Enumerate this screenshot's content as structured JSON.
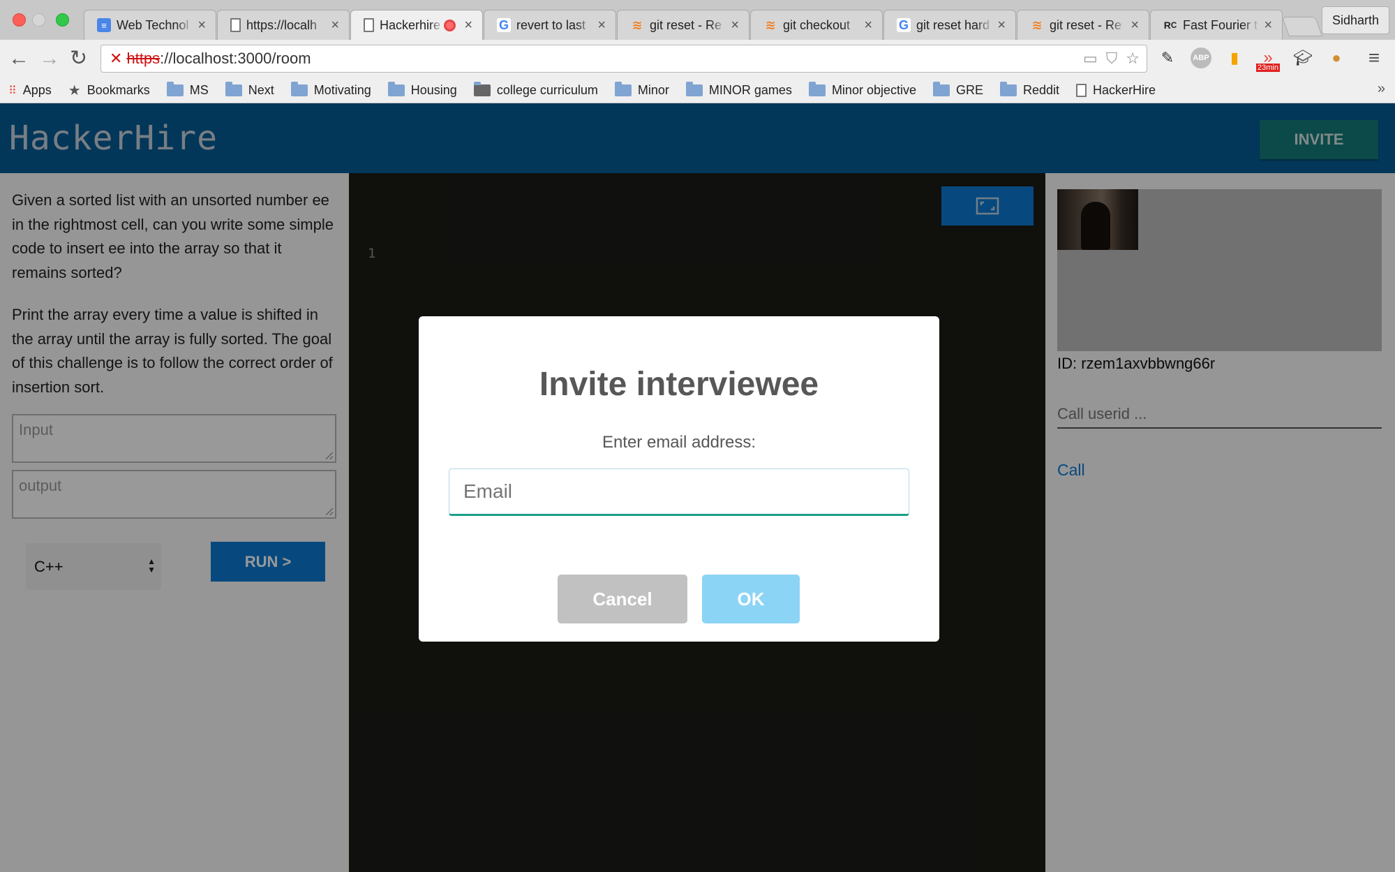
{
  "browser": {
    "tabs": [
      {
        "title": "Web Technol",
        "icon": "docs-icon"
      },
      {
        "title": "https://localh",
        "icon": "page-icon"
      },
      {
        "title": "Hackerhire",
        "icon": "page-icon",
        "active": true,
        "recording": true
      },
      {
        "title": "revert to last",
        "icon": "google-icon"
      },
      {
        "title": "git reset - Re",
        "icon": "stackoverflow-icon"
      },
      {
        "title": "git checkout",
        "icon": "stackoverflow-icon"
      },
      {
        "title": "git reset hard",
        "icon": "google-icon"
      },
      {
        "title": "git reset - Re",
        "icon": "stackoverflow-icon"
      },
      {
        "title": "Fast Fourier t",
        "icon": "rc-icon"
      }
    ],
    "profile_name": "Sidharth",
    "url_scheme": "https",
    "url_rest": "://localhost:3000/room",
    "extension_badge": "23min",
    "bookmarks": [
      {
        "label": "Apps",
        "icon": "apps-grid-icon"
      },
      {
        "label": "Bookmarks",
        "icon": "star-icon"
      },
      {
        "label": "MS",
        "icon": "folder-icon"
      },
      {
        "label": "Next",
        "icon": "folder-icon"
      },
      {
        "label": "Motivating",
        "icon": "folder-icon"
      },
      {
        "label": "Housing",
        "icon": "folder-icon"
      },
      {
        "label": "college curriculum",
        "icon": "folder-icon"
      },
      {
        "label": "Minor",
        "icon": "folder-icon"
      },
      {
        "label": "MINOR games",
        "icon": "folder-icon"
      },
      {
        "label": "Minor objective",
        "icon": "folder-icon"
      },
      {
        "label": "GRE",
        "icon": "folder-icon"
      },
      {
        "label": "Reddit",
        "icon": "folder-icon"
      },
      {
        "label": "HackerHire",
        "icon": "page-icon"
      }
    ],
    "overflow_label": "»"
  },
  "app": {
    "logo": "HackerHire",
    "invite_label": "INVITE"
  },
  "question": {
    "paragraph_1": "Given a sorted list with an unsorted number ee in the rightmost cell, can you write some simple code to insert ee into the array so that it remains sorted?",
    "paragraph_2": "Print the array every time a value is shifted in the array until the array is fully sorted. The goal of this challenge is to follow the correct order of insertion sort.",
    "input_placeholder": "Input",
    "output_placeholder": "output",
    "language": "C++",
    "run_label": "RUN >"
  },
  "editor": {
    "line_numbers": [
      "1"
    ]
  },
  "video": {
    "peer_id": "ID: rzem1axvbbwng66r",
    "call_placeholder": "Call userid ...",
    "call_label": "Call"
  },
  "dialog": {
    "title": "Invite interviewee",
    "subtitle": "Enter email address:",
    "email_placeholder": "Email",
    "cancel_label": "Cancel",
    "ok_label": "OK"
  },
  "colors": {
    "header_bg": "#065d97",
    "invite_bg": "#137c7a",
    "primary_button": "#0c7ad2",
    "editor_bg": "#1b1b17",
    "ok_button": "#8cd4f5",
    "cancel_button": "#c1c1c1",
    "input_focus": "#1a9f85"
  }
}
